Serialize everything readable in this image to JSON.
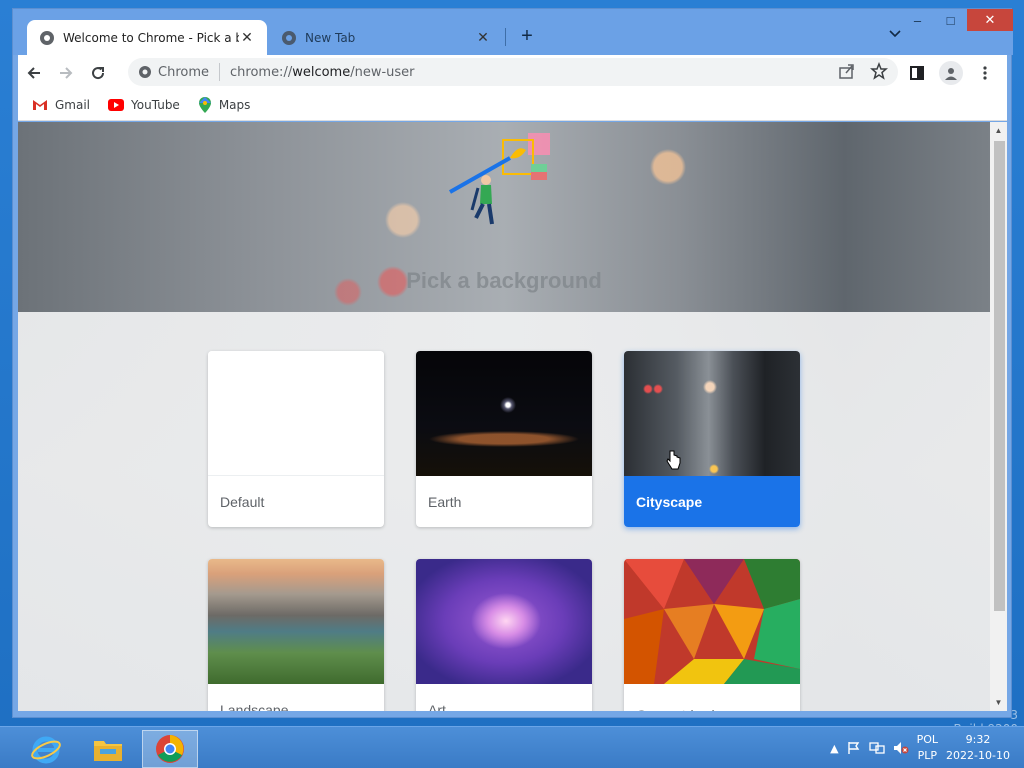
{
  "desktop": {
    "watermark_line1": "3",
    "watermark_line2": "Build 9200"
  },
  "window": {
    "minimize": "–",
    "maximize": "□",
    "close": "✕"
  },
  "tabs": [
    {
      "title": "Welcome to Chrome - Pick a bac",
      "active": true
    },
    {
      "title": "New Tab",
      "active": false
    }
  ],
  "toolbar": {
    "site_chip": "Chrome",
    "url_prefix": "chrome://",
    "url_host": "welcome",
    "url_path": "/new-user"
  },
  "bookmarks": [
    {
      "label": "Gmail",
      "icon": "gmail-icon"
    },
    {
      "label": "YouTube",
      "icon": "youtube-icon"
    },
    {
      "label": "Maps",
      "icon": "maps-icon"
    }
  ],
  "page": {
    "title": "Pick a background"
  },
  "backgrounds": [
    {
      "label": "Default",
      "selected": false
    },
    {
      "label": "Earth",
      "selected": false
    },
    {
      "label": "Cityscape",
      "selected": true
    },
    {
      "label": "Landscape",
      "selected": false
    },
    {
      "label": "Art",
      "selected": false
    },
    {
      "label": "Geometric shapes",
      "selected": false
    }
  ],
  "taskbar": {
    "apps": [
      "internet-explorer-icon",
      "file-explorer-icon",
      "chrome-icon"
    ],
    "language_top": "POL",
    "language_bottom": "PLP",
    "time": "9:32",
    "date": "2022-10-10"
  },
  "colors": {
    "accent": "#1a73e8",
    "taskbar": "#3a7bc6",
    "close_button": "#c7463c"
  }
}
